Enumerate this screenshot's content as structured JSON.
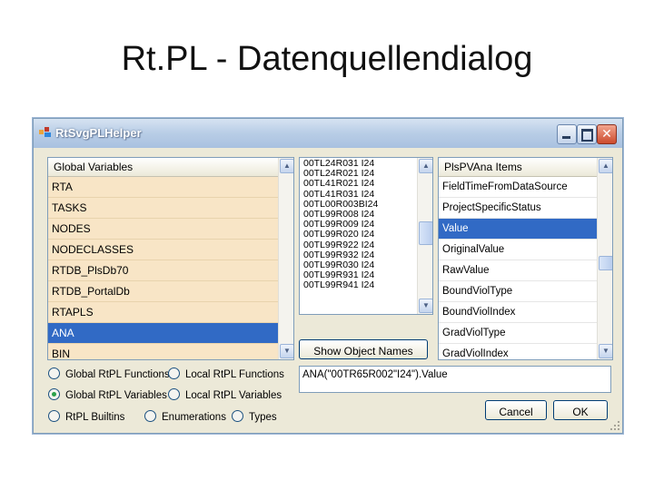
{
  "slide": {
    "title": "Rt.PL - Datenquellendialog"
  },
  "window": {
    "title": "RtSvgPLHelper",
    "close_glyph": "✕"
  },
  "global_variables": {
    "header": "Global Variables",
    "items": [
      "RTA",
      "TASKS",
      "NODES",
      "NODECLASSES",
      "RTDB_PlsDb70",
      "RTDB_PortalDb",
      "RTAPLS",
      "ANA",
      "BIN"
    ],
    "selected": "ANA"
  },
  "objects": {
    "items": [
      "00TL24R031 I24",
      "00TL24R021 I24",
      "00TL41R021 I24",
      "00TL41R031 I24",
      "00TL00R003BI24",
      "00TL99R008 I24",
      "00TL99R009 I24",
      "00TL99R020 I24",
      "00TL99R922 I24",
      "00TL99R932 I24",
      "00TL99R030 I24",
      "00TL99R931 I24",
      "00TL99R941 I24"
    ],
    "show_button": "Show Object Names"
  },
  "pv_items": {
    "header": "PlsPVAna Items",
    "items": [
      "FieldTimeFromDataSource",
      "ProjectSpecificStatus",
      "Value",
      "OriginalValue",
      "RawValue",
      "BoundViolType",
      "BoundViolIndex",
      "GradViolType",
      "GradViolIndex"
    ],
    "selected": "Value"
  },
  "radios": [
    {
      "label": "Global RtPL Functions",
      "checked": false
    },
    {
      "label": "Local RtPL Functions",
      "checked": false
    },
    {
      "label": "Global RtPL Variables",
      "checked": true
    },
    {
      "label": "Local RtPL Variables",
      "checked": false
    },
    {
      "label": "RtPL Builtins",
      "checked": false
    },
    {
      "label": "Enumerations",
      "checked": false
    },
    {
      "label": "Types",
      "checked": false
    }
  ],
  "expression": "ANA(\"00TR65R002\"I24\").Value",
  "buttons": {
    "cancel": "Cancel",
    "ok": "OK"
  },
  "colors": {
    "selection": "#316ac5",
    "list_bg": "#f8e5c6",
    "dialog_bg": "#ece9d8"
  }
}
